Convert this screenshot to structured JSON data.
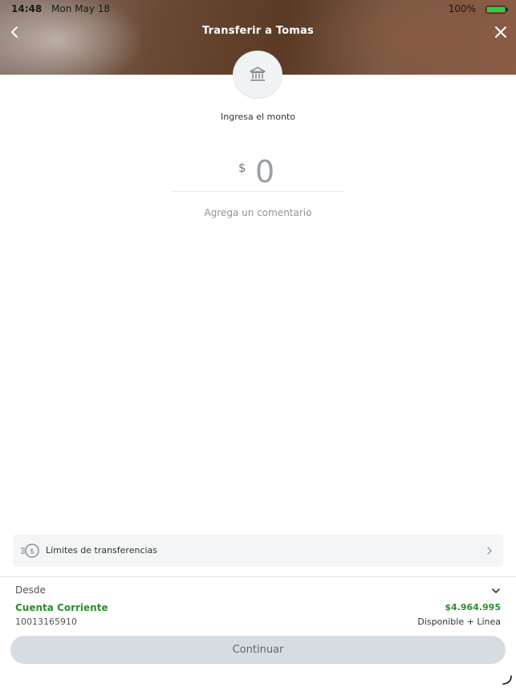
{
  "status_bar": {
    "time": "14:48",
    "date": "Mon May 18",
    "battery_percent": "100%"
  },
  "header": {
    "title": "Transferir a Tomas"
  },
  "amount_section": {
    "prompt": "Ingresa el monto",
    "currency_symbol": "$",
    "amount_value": "0",
    "comment_placeholder": "Agrega un comentario"
  },
  "limits": {
    "label": "Límites de transferencias"
  },
  "source_account": {
    "label": "Desde",
    "account_name": "Cuenta Corriente",
    "account_number": "10013165910",
    "balance": "$4.964.995",
    "balance_label": "Disponible + Línea"
  },
  "actions": {
    "continue_label": "Continuar"
  },
  "colors": {
    "accent_green": "#2e8b2e",
    "button_disabled": "#d6dce2"
  },
  "icons": {
    "back": "chevron-left-icon",
    "close": "close-icon",
    "bank": "bank-icon",
    "limits": "money-speed-icon",
    "limits_chevron": "chevron-right-icon",
    "desde_chevron": "chevron-down-icon"
  }
}
